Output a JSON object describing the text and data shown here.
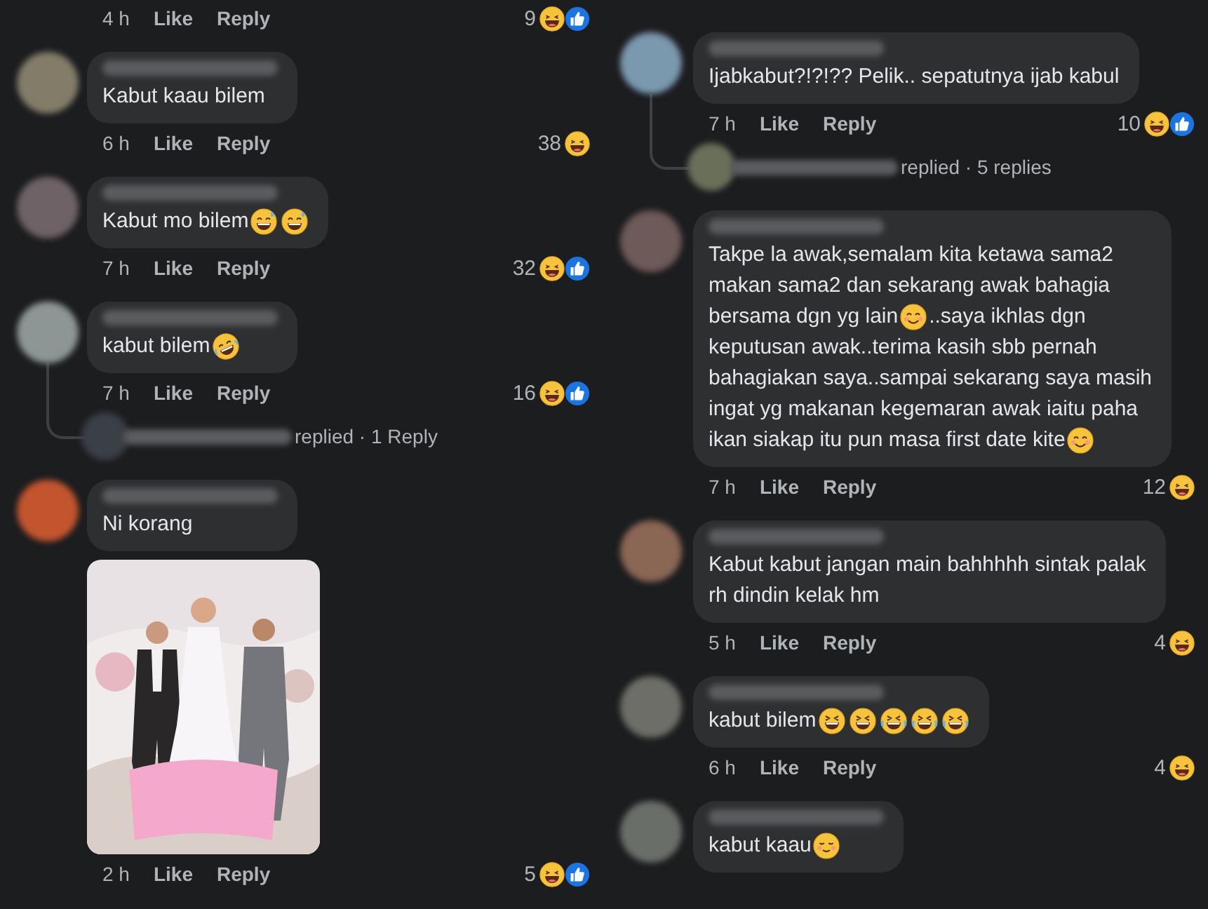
{
  "columns": [
    {
      "items": [
        {
          "kind": "footer",
          "time": "4 h",
          "like": "Like",
          "reply": "Reply",
          "count": "9",
          "reactions": [
            {
              "kind": "haha"
            },
            {
              "kind": "like"
            }
          ]
        },
        {
          "kind": "comment",
          "avatar": {
            "color": "#837c68"
          },
          "lines": [
            [
              {
                "kind": "text",
                "text": "Kabut kaau bilem"
              }
            ]
          ],
          "time": "6 h",
          "like": "Like",
          "reply": "Reply",
          "count": "38",
          "reactions": [
            {
              "kind": "haha"
            }
          ]
        },
        {
          "kind": "comment",
          "avatar": {
            "color": "#6f6266"
          },
          "lines": [
            [
              {
                "kind": "text",
                "text": "Kabut mo bilem"
              },
              {
                "kind": "sweat"
              },
              {
                "kind": "sweat"
              }
            ]
          ],
          "time": "7 h",
          "like": "Like",
          "reply": "Reply",
          "count": "32",
          "reactions": [
            {
              "kind": "haha"
            },
            {
              "kind": "like"
            }
          ]
        },
        {
          "kind": "comment",
          "avatar": {
            "color": "#8d9694"
          },
          "lines": [
            [
              {
                "kind": "text",
                "text": "kabut bilem"
              },
              {
                "kind": "rofl"
              }
            ]
          ],
          "time": "7 h",
          "like": "Like",
          "reply": "Reply",
          "count": "16",
          "reactions": [
            {
              "kind": "haha"
            },
            {
              "kind": "like"
            }
          ],
          "replies_summary": {
            "avatar": {
              "color": "#3b3f47"
            },
            "text": "replied · 1 Reply"
          }
        },
        {
          "kind": "comment",
          "avatar": {
            "color": "#c2552e"
          },
          "lines": [
            [
              {
                "kind": "text",
                "text": "Ni korang"
              }
            ]
          ],
          "image": {
            "kind": "picture"
          },
          "time": "2 h",
          "like": "Like",
          "reply": "Reply",
          "count": "5",
          "reactions": [
            {
              "kind": "haha"
            },
            {
              "kind": "like"
            }
          ]
        }
      ]
    },
    {
      "items": [
        {
          "kind": "comment",
          "avatar": {
            "color": "#7a98ae"
          },
          "lines": [
            [
              {
                "kind": "text",
                "text": "Ijabkabut?!?!?? Pelik.. sepatutnya ijab kabul"
              }
            ]
          ],
          "time": "7 h",
          "like": "Like",
          "reply": "Reply",
          "count": "10",
          "reactions": [
            {
              "kind": "haha"
            },
            {
              "kind": "like"
            }
          ],
          "replies_summary": {
            "avatar": {
              "color": "#6a6f5a"
            },
            "text": "replied · 5 replies"
          }
        },
        {
          "kind": "comment",
          "avatar": {
            "color": "#6e5a58"
          },
          "lines": [
            [
              {
                "kind": "text",
                "text": "Takpe la awak,semalam kita ketawa sama2"
              }
            ],
            [
              {
                "kind": "text",
                "text": "makan sama2 dan sekarang awak bahagia"
              }
            ],
            [
              {
                "kind": "text",
                "text": "bersama dgn yg lain"
              },
              {
                "kind": "smile"
              },
              {
                "kind": "text",
                "text": "..saya ikhlas dgn"
              }
            ],
            [
              {
                "kind": "text",
                "text": "keputusan awak..terima kasih sbb pernah"
              }
            ],
            [
              {
                "kind": "text",
                "text": "bahagiakan saya..sampai sekarang saya masih"
              }
            ],
            [
              {
                "kind": "text",
                "text": "ingat yg makanan kegemaran awak iaitu paha"
              }
            ],
            [
              {
                "kind": "text",
                "text": "ikan siakap itu pun masa first date kite"
              },
              {
                "kind": "smile"
              }
            ]
          ],
          "time": "7 h",
          "like": "Like",
          "reply": "Reply",
          "count": "12",
          "reactions": [
            {
              "kind": "haha"
            }
          ]
        },
        {
          "kind": "comment",
          "avatar": {
            "color": "#8a6654"
          },
          "lines": [
            [
              {
                "kind": "text",
                "text": "Kabut kabut jangan main bahhhhh sintak palak"
              }
            ],
            [
              {
                "kind": "text",
                "text": "rh dindin kelak hm"
              }
            ]
          ],
          "time": "5 h",
          "like": "Like",
          "reply": "Reply",
          "count": "4",
          "reactions": [
            {
              "kind": "haha"
            }
          ]
        },
        {
          "kind": "comment",
          "avatar": {
            "color": "#6e6e68"
          },
          "lines": [
            [
              {
                "kind": "text",
                "text": "kabut bilem"
              },
              {
                "kind": "squint"
              },
              {
                "kind": "squint"
              },
              {
                "kind": "tears"
              },
              {
                "kind": "tears"
              },
              {
                "kind": "tears"
              }
            ]
          ],
          "time": "6 h",
          "like": "Like",
          "reply": "Reply",
          "count": "4",
          "reactions": [
            {
              "kind": "haha"
            }
          ]
        },
        {
          "kind": "comment",
          "avatar": {
            "color": "#6a6e69"
          },
          "lines": [
            [
              {
                "kind": "text",
                "text": "kabut kaau"
              },
              {
                "kind": "relieved"
              }
            ]
          ]
        }
      ]
    }
  ]
}
